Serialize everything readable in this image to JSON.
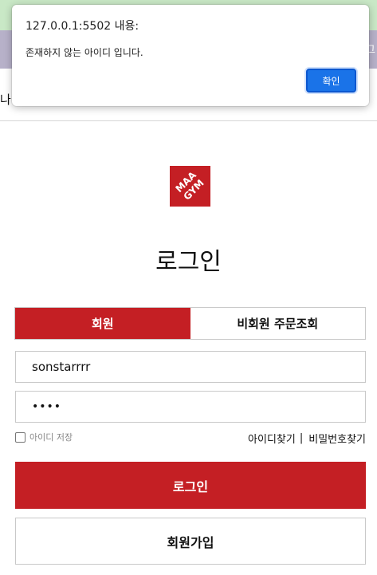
{
  "alert": {
    "title": "127.0.0.1:5502 내용:",
    "message": "존재하지 않는 아이디 입니다.",
    "ok_label": "확인"
  },
  "background": {
    "top_right_fragment": "로그",
    "nav_left_fragment": "나"
  },
  "logo": {
    "text_top": "MAA",
    "text_bottom": "GYM",
    "color": "#c41f24"
  },
  "login": {
    "title": "로그인",
    "tabs": [
      {
        "label": "회원",
        "active": true
      },
      {
        "label": "비회원 주문조회",
        "active": false
      }
    ],
    "username_value": "sonstarrrr",
    "password_mask": "••••",
    "save_id_label": "아이디 저장",
    "find_id_label": "아이디찾기",
    "separator": "|",
    "find_pw_label": "비밀번호찾기",
    "login_button": "로그인",
    "signup_button": "회원가입"
  },
  "colors": {
    "brand_red": "#c41f24",
    "alert_button_blue": "#1a73e8"
  }
}
